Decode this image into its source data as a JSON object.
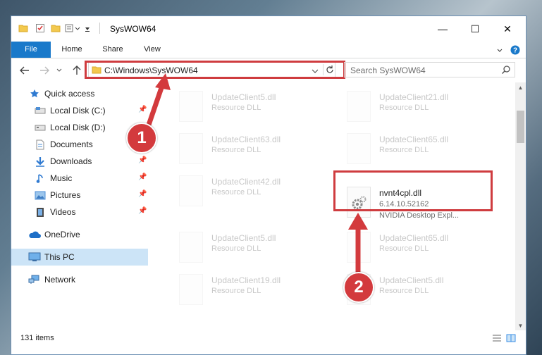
{
  "window": {
    "title": "SysWOW64",
    "controls": {
      "minimize": "—",
      "maximize": "☐",
      "close": "✕"
    }
  },
  "ribbon": {
    "tabs": [
      "File",
      "Home",
      "Share",
      "View"
    ]
  },
  "address": {
    "path": "C:\\Windows\\SysWOW64",
    "search_placeholder": "Search SysWOW64"
  },
  "sidebar": {
    "items": [
      {
        "label": "Quick access",
        "icon": "star-icon",
        "pinned": false
      },
      {
        "label": "Local Disk (C:)",
        "icon": "drive-icon",
        "pinned": true
      },
      {
        "label": "Local Disk (D:)",
        "icon": "drive-icon",
        "pinned": false
      },
      {
        "label": "Documents",
        "icon": "document-icon",
        "pinned": true
      },
      {
        "label": "Downloads",
        "icon": "download-icon",
        "pinned": true
      },
      {
        "label": "Music",
        "icon": "music-icon",
        "pinned": true
      },
      {
        "label": "Pictures",
        "icon": "pictures-icon",
        "pinned": true
      },
      {
        "label": "Videos",
        "icon": "video-icon",
        "pinned": true
      },
      {
        "label": "OneDrive",
        "icon": "cloud-icon",
        "pinned": false
      },
      {
        "label": "This PC",
        "icon": "computer-icon",
        "pinned": false,
        "selected": true
      },
      {
        "label": "Network",
        "icon": "network-icon",
        "pinned": false
      }
    ]
  },
  "files": [
    {
      "name": "UpdateClient5.dll",
      "desc": "Resource DLL"
    },
    {
      "name": "UpdateClient21.dll",
      "desc": "Resource DLL"
    },
    {
      "name": "UpdateClient63.dll",
      "desc": "Resource DLL"
    },
    {
      "name": "UpdateClient65.dll",
      "desc": "Resource DLL"
    },
    {
      "name": "UpdateClient42.dll",
      "desc": "Resource DLL"
    },
    {
      "name": "nvnt4cpl.dll",
      "desc": "6.14.10.52162",
      "desc2": "NVIDIA Desktop Expl..."
    },
    {
      "name": "UpdateClient5.dll",
      "desc": "Resource DLL"
    },
    {
      "name": "UpdateClient65.dll",
      "desc": "Resource DLL"
    },
    {
      "name": "UpdateClient19.dll",
      "desc": "Resource DLL"
    },
    {
      "name": "UpdateClient5.dll",
      "desc": "Resource DLL"
    }
  ],
  "status": {
    "item_count": "131 items"
  },
  "annotations": {
    "marker1": "1",
    "marker2": "2",
    "color": "#d33a3d"
  }
}
